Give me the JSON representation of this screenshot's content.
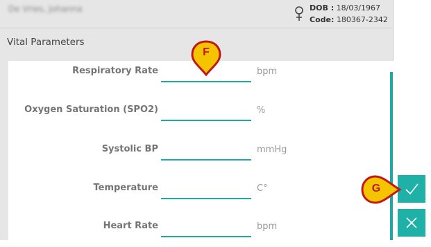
{
  "patient": {
    "name": "De Vries, Johanna",
    "dob_label": "DOB :",
    "dob": "18/03/1967",
    "code_label": "Code:",
    "code": "180367-2342",
    "gender_icon": "female-icon"
  },
  "section": {
    "title": "Vital Parameters"
  },
  "fields": [
    {
      "label": "Respiratory Rate",
      "value": "",
      "unit": "bpm"
    },
    {
      "label": "Oxygen Saturation (SPO2)",
      "value": "",
      "unit": "%"
    },
    {
      "label": "Systolic BP",
      "value": "",
      "unit": "mmHg"
    },
    {
      "label": "Temperature",
      "value": "",
      "unit": "C°"
    },
    {
      "label": "Heart Rate",
      "value": "",
      "unit": "bpm"
    }
  ],
  "actions": {
    "confirm_icon": "check-icon",
    "cancel_icon": "close-icon"
  },
  "annotations": [
    {
      "letter": "F"
    },
    {
      "letter": "G"
    }
  ],
  "colors": {
    "accent": "#1fb0a8",
    "marker_fill": "#f5c400",
    "marker_border": "#c01818"
  }
}
